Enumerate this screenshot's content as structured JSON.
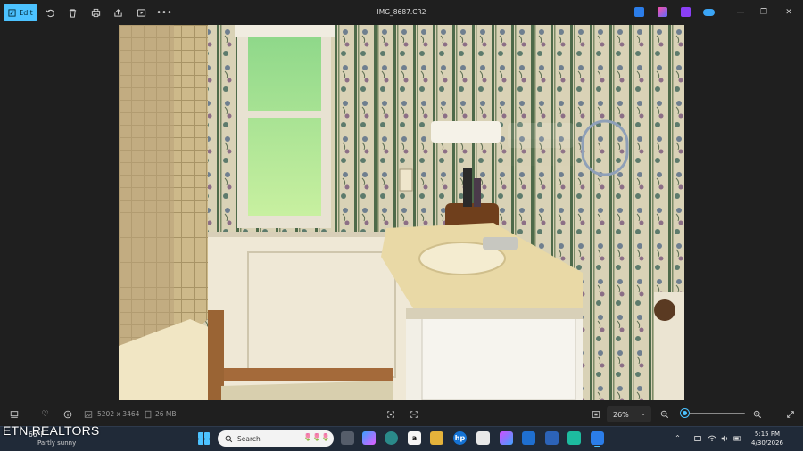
{
  "titlebar": {
    "edit_label": "Edit",
    "file_title": "IMG_8687.CR2",
    "toolbar_icons": [
      "rotate-icon",
      "delete-icon",
      "print-icon",
      "share-icon",
      "slideshow-icon",
      "more-icon"
    ],
    "window_controls": [
      "minimize",
      "maximize",
      "close"
    ]
  },
  "bottombar": {
    "dimensions": "5202 x 3464",
    "file_size": "26 MB",
    "zoom_level": "26%",
    "zoom_slider_fraction": 0.06
  },
  "taskbar": {
    "weather_temp": "66°F",
    "weather_desc": "Partly sunny",
    "search_placeholder": "Search",
    "time": "5:15 PM",
    "date": "4/30/2026"
  },
  "watermark": "ETN REALTORS",
  "colors": {
    "accent": "#4cc2ff",
    "app_bg": "#1f1f1f",
    "taskbar_bg": "#202a38"
  }
}
